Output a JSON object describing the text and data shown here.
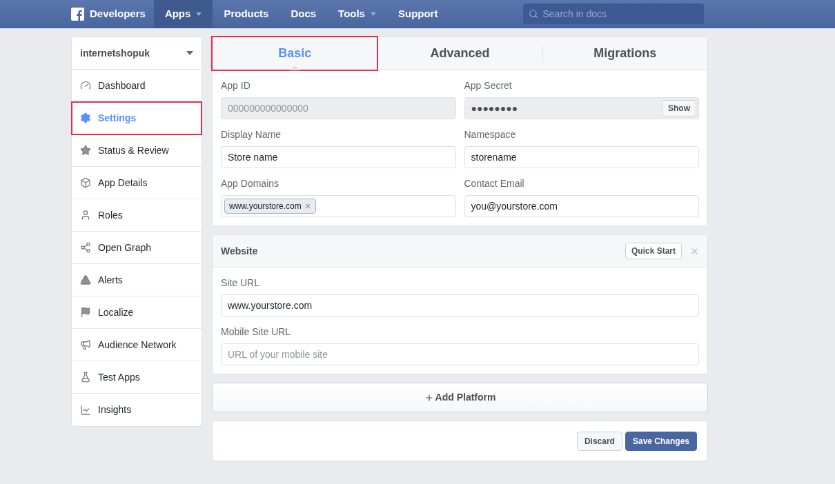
{
  "topbar": {
    "brand": "Developers",
    "nav": [
      {
        "label": "Apps",
        "selected": true,
        "dropdown": true
      },
      {
        "label": "Products",
        "selected": false,
        "dropdown": false
      },
      {
        "label": "Docs",
        "selected": false,
        "dropdown": false
      },
      {
        "label": "Tools",
        "selected": false,
        "dropdown": true
      },
      {
        "label": "Support",
        "selected": false,
        "dropdown": false
      }
    ],
    "search": {
      "placeholder": "Search in docs"
    }
  },
  "sidebar": {
    "app_name": "internetshopuk",
    "items": [
      {
        "label": "Dashboard",
        "selected": false,
        "highlighted": false
      },
      {
        "label": "Settings",
        "selected": true,
        "highlighted": true
      },
      {
        "label": "Status & Review",
        "selected": false,
        "highlighted": false
      },
      {
        "label": "App Details",
        "selected": false,
        "highlighted": false
      },
      {
        "label": "Roles",
        "selected": false,
        "highlighted": false
      },
      {
        "label": "Open Graph",
        "selected": false,
        "highlighted": false
      },
      {
        "label": "Alerts",
        "selected": false,
        "highlighted": false
      },
      {
        "label": "Localize",
        "selected": false,
        "highlighted": false
      },
      {
        "label": "Audience Network",
        "selected": false,
        "highlighted": false
      },
      {
        "label": "Test Apps",
        "selected": false,
        "highlighted": false
      },
      {
        "label": "Insights",
        "selected": false,
        "highlighted": false
      }
    ]
  },
  "tabs": [
    {
      "label": "Basic",
      "selected": true,
      "highlighted": true
    },
    {
      "label": "Advanced",
      "selected": false,
      "highlighted": false
    },
    {
      "label": "Migrations",
      "selected": false,
      "highlighted": false
    }
  ],
  "basic": {
    "fields": [
      {
        "label": "App ID",
        "kind": "readonly",
        "value": "000000000000000"
      },
      {
        "label": "App Secret",
        "kind": "secret",
        "value": "●●●●●●●●",
        "button": "Show"
      },
      {
        "label": "Display Name",
        "kind": "text",
        "value": "Store name"
      },
      {
        "label": "Namespace",
        "kind": "text",
        "value": "storename"
      },
      {
        "label": "App Domains",
        "kind": "tags",
        "tags": [
          "www.yourstore.com"
        ]
      },
      {
        "label": "Contact Email",
        "kind": "text",
        "value": "you@yourstore.com"
      }
    ]
  },
  "website": {
    "title": "Website",
    "quick_start": "Quick Start",
    "fields": [
      {
        "label": "Site URL",
        "value": "www.yourstore.com"
      },
      {
        "label": "Mobile Site URL",
        "placeholder": "URL of your mobile site"
      }
    ]
  },
  "add_platform": "Add Platform",
  "footer": {
    "discard": "Discard",
    "save": "Save Changes"
  }
}
